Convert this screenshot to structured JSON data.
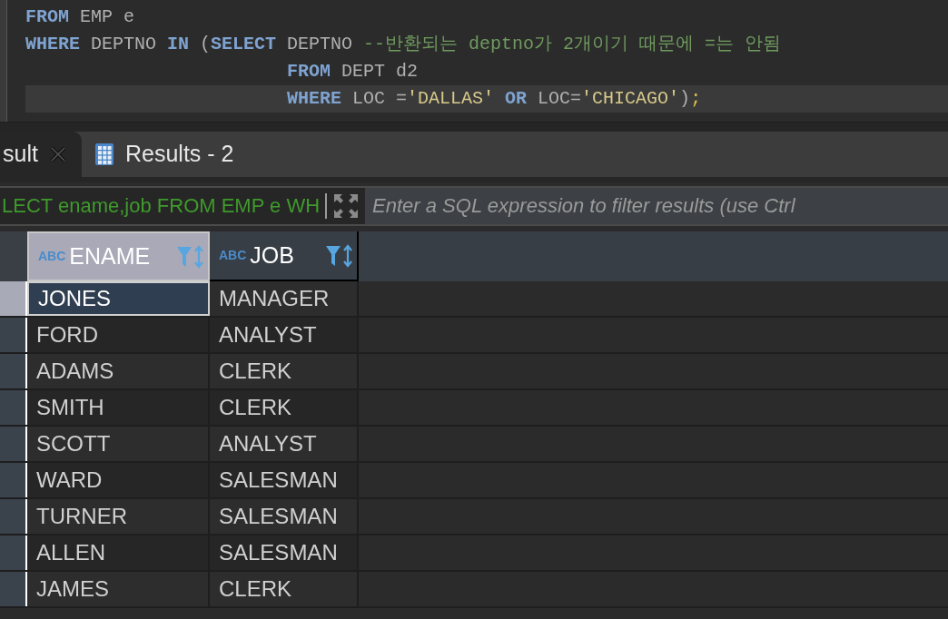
{
  "editor": {
    "lines": [
      {
        "current": false,
        "indented": false,
        "tokens": [
          {
            "kind": "keyword",
            "text": "FROM"
          },
          {
            "kind": "plain",
            "text": " EMP e"
          }
        ]
      },
      {
        "current": false,
        "indented": false,
        "tokens": [
          {
            "kind": "keyword",
            "text": "WHERE"
          },
          {
            "kind": "plain",
            "text": " DEPTNO "
          },
          {
            "kind": "keyword",
            "text": "IN"
          },
          {
            "kind": "plain",
            "text": " ("
          },
          {
            "kind": "keyword",
            "text": "SELECT"
          },
          {
            "kind": "plain",
            "text": " DEPTNO "
          },
          {
            "kind": "comment",
            "text": "--반환되는 deptno가 2개이기 때문에 =는 안됨"
          }
        ]
      },
      {
        "current": false,
        "indented": true,
        "tokens": [
          {
            "kind": "keyword",
            "text": "FROM"
          },
          {
            "kind": "plain",
            "text": " DEPT d2"
          }
        ]
      },
      {
        "current": true,
        "indented": true,
        "tokens": [
          {
            "kind": "keyword",
            "text": "WHERE"
          },
          {
            "kind": "plain",
            "text": " LOC ="
          },
          {
            "kind": "string",
            "text": "'DALLAS'"
          },
          {
            "kind": "keyword",
            "text": " OR"
          },
          {
            "kind": "plain",
            "text": " LOC="
          },
          {
            "kind": "string",
            "text": "'CHICAGO'"
          },
          {
            "kind": "plain",
            "text": ")"
          },
          {
            "kind": "punct",
            "text": ";"
          }
        ]
      }
    ]
  },
  "tabs": [
    {
      "label": "sult",
      "selected": true,
      "closable": true
    },
    {
      "label": "Results - 2",
      "selected": false,
      "closable": false
    }
  ],
  "filter_bar": {
    "query": "LECT ename,job FROM EMP e WH",
    "placeholder": "Enter a SQL expression to filter results (use Ctrl"
  },
  "table": {
    "columns": [
      {
        "type_badge": "ABC",
        "name": "ENAME",
        "selected": true
      },
      {
        "type_badge": "ABC",
        "name": "JOB",
        "selected": false
      }
    ],
    "rows": [
      {
        "selected": true,
        "cells": [
          "JONES",
          "MANAGER"
        ]
      },
      {
        "selected": false,
        "cells": [
          "FORD",
          "ANALYST"
        ]
      },
      {
        "selected": false,
        "cells": [
          "ADAMS",
          "CLERK"
        ]
      },
      {
        "selected": false,
        "cells": [
          "SMITH",
          "CLERK"
        ]
      },
      {
        "selected": false,
        "cells": [
          "SCOTT",
          "ANALYST"
        ]
      },
      {
        "selected": false,
        "cells": [
          "WARD",
          "SALESMAN"
        ]
      },
      {
        "selected": false,
        "cells": [
          "TURNER",
          "SALESMAN"
        ]
      },
      {
        "selected": false,
        "cells": [
          "ALLEN",
          "SALESMAN"
        ]
      },
      {
        "selected": false,
        "cells": [
          "JAMES",
          "CLERK"
        ]
      }
    ]
  }
}
